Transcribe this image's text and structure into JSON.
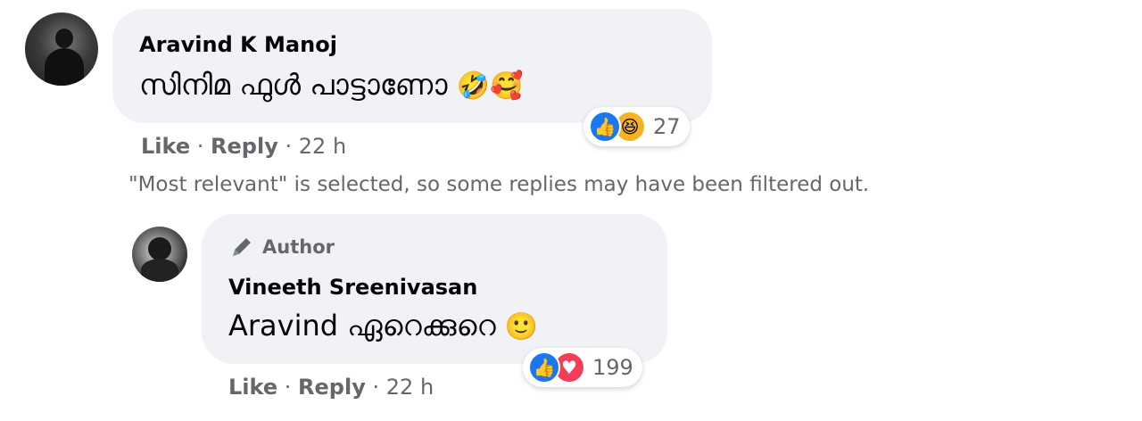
{
  "comment": {
    "author": "Aravind K Manoj",
    "text": "സിനിമ ഫുൾ പാട്ടാണോ",
    "emojis": [
      "🤣",
      "🥰"
    ],
    "reactions": {
      "icons": [
        "like-icon",
        "haha-icon"
      ],
      "count": "27"
    },
    "actions": {
      "like": "Like",
      "separator": "·",
      "reply": "Reply",
      "time": "22 h"
    }
  },
  "filter_note": "\"Most relevant\" is selected, so some replies may have been filtered out.",
  "reply": {
    "badge": "Author",
    "author": "Vineeth Sreenivasan",
    "text": "Aravind ഏറെക്കുറെ",
    "emoji": "🙂",
    "reactions": {
      "icons": [
        "like-icon",
        "love-icon"
      ],
      "count": "199"
    },
    "actions": {
      "like": "Like",
      "separator": "·",
      "reply": "Reply",
      "time": "22 h"
    }
  },
  "colors": {
    "bubble": "#f0f2f5",
    "secondary_text": "#65676b",
    "like_blue": "#1877f2",
    "love_red": "#f33e58",
    "haha_yellow": "#f7b125"
  }
}
